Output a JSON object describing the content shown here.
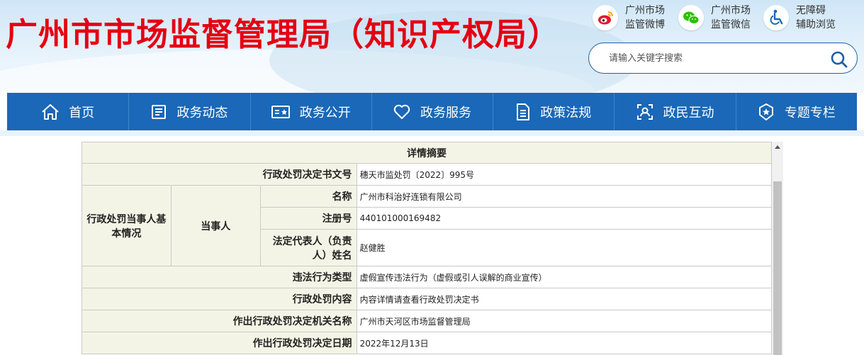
{
  "header": {
    "site_title": "广州市市场监督管理局（知识产权局）",
    "top_links": [
      {
        "icon": "weibo-icon",
        "line1": "广州市场",
        "line2": "监管微博"
      },
      {
        "icon": "wechat-icon",
        "line1": "广州市场",
        "line2": "监管微信"
      },
      {
        "icon": "accessibility-icon",
        "line1": "无障碍",
        "line2": "辅助浏览"
      }
    ],
    "search": {
      "placeholder": "请输入关键字搜索"
    }
  },
  "nav": {
    "items": [
      {
        "label": "首页",
        "icon": "home-icon"
      },
      {
        "label": "政务动态",
        "icon": "news-icon"
      },
      {
        "label": "政务公开",
        "icon": "public-info-icon"
      },
      {
        "label": "政务服务",
        "icon": "service-heart-icon"
      },
      {
        "label": "政策法规",
        "icon": "document-icon"
      },
      {
        "label": "政民互动",
        "icon": "interaction-icon"
      },
      {
        "label": "专题专栏",
        "icon": "badge-icon"
      }
    ]
  },
  "detail": {
    "title": "详情摘要",
    "decision_no_label": "行政处罚决定书文号",
    "decision_no": "穗天市监处罚〔2022〕995号",
    "party_basic_label": "行政处罚当事人基本情况",
    "party_label": "当事人",
    "name_label": "名称",
    "name": "广州市科治好连锁有限公司",
    "reg_label": "注册号",
    "reg_no": "440101000169482",
    "legal_rep_label": "法定代表人（负责人）姓名",
    "legal_rep": "赵健胜",
    "violation_type_label": "违法行为类型",
    "violation_type": "虚假宣传违法行为（虚假或引人误解的商业宣传）",
    "content_label": "行政处罚内容",
    "content": "内容详情请查看行政处罚决定书",
    "authority_label": "作出行政处罚决定机关名称",
    "authority": "广州市天河区市场监督管理局",
    "date_label": "作出行政处罚决定日期",
    "date": "2022年12月13日"
  },
  "colors": {
    "title_red": "#e40012",
    "nav_blue": "#1a68b7",
    "label_bg": "#f4f4e6"
  }
}
